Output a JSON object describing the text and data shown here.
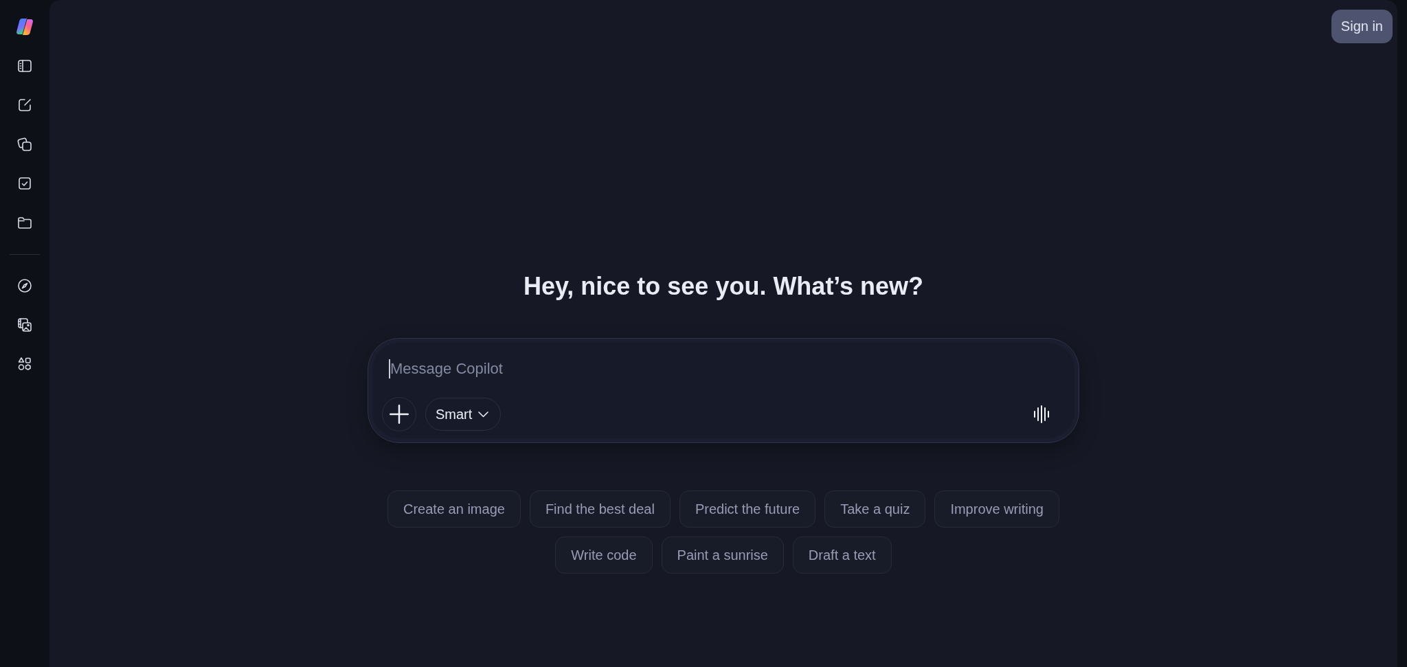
{
  "header": {
    "sign_in": "Sign in"
  },
  "greeting": "Hey, nice to see you. What’s new?",
  "composer": {
    "placeholder": "Message Copilot",
    "mode": "Smart"
  },
  "suggestion_rows": [
    [
      "Create an image",
      "Find the best deal",
      "Predict the future",
      "Take a quiz",
      "Improve writing"
    ],
    [
      "Write code",
      "Paint a sunrise",
      "Draft a text"
    ]
  ]
}
